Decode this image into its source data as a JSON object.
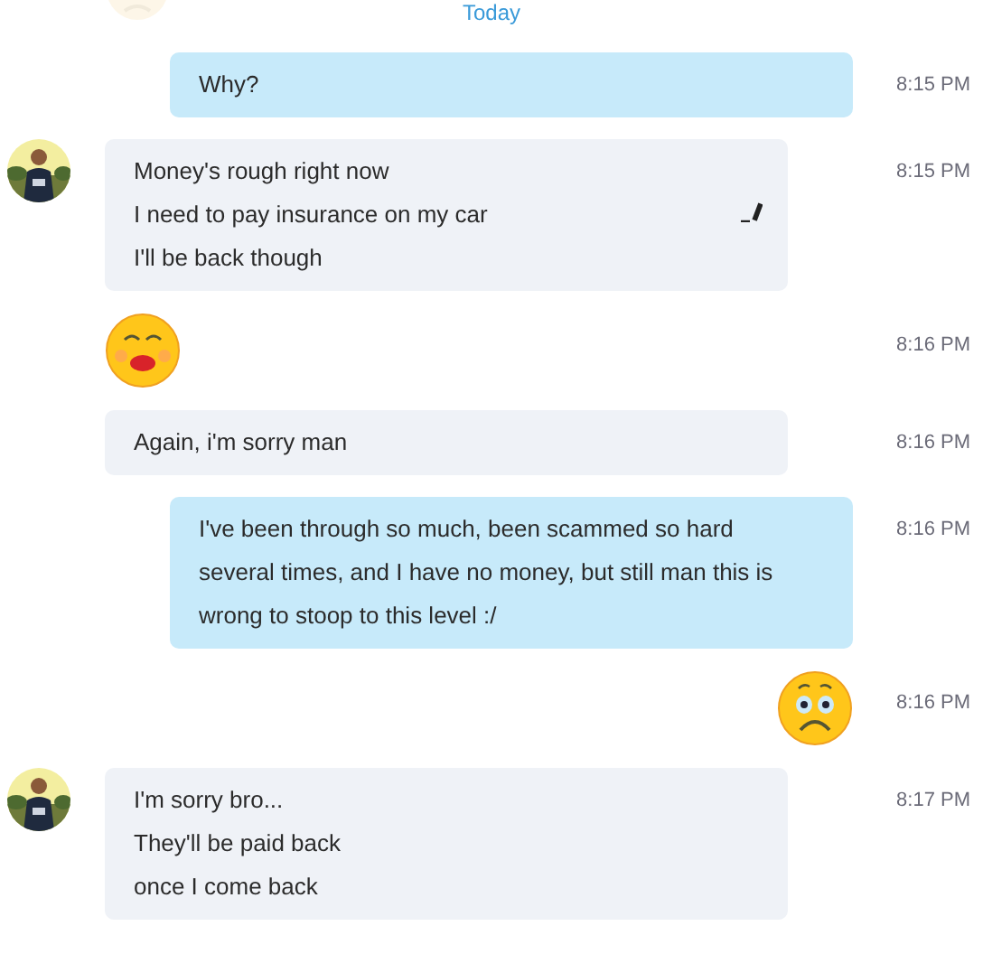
{
  "date_divider": "Today",
  "messages": [
    {
      "kind": "sent_text",
      "avatar": false,
      "edited": false,
      "lines": [
        "Why?"
      ],
      "time": "8:15 PM"
    },
    {
      "kind": "received_text",
      "avatar": true,
      "edited": true,
      "lines": [
        "Money's rough right now",
        "I need to pay insurance on my car",
        "I'll be back though"
      ],
      "time": "8:15 PM"
    },
    {
      "kind": "received_kiss",
      "avatar": false,
      "time": "8:16 PM"
    },
    {
      "kind": "received_text",
      "avatar": false,
      "edited": false,
      "lines": [
        "Again, i'm sorry man"
      ],
      "time": "8:16 PM"
    },
    {
      "kind": "sent_text",
      "avatar": false,
      "edited": false,
      "lines": [
        "I've been through so much, been scammed so hard several times, and I have no money, but still man this is wrong to stoop to this level :/"
      ],
      "time": "8:16 PM"
    },
    {
      "kind": "sent_sad",
      "avatar": false,
      "time": "8:16 PM"
    },
    {
      "kind": "received_text",
      "avatar": true,
      "edited": false,
      "lines": [
        "I'm sorry bro...",
        "They'll be paid back",
        "once I come back"
      ],
      "time": "8:17 PM"
    }
  ]
}
